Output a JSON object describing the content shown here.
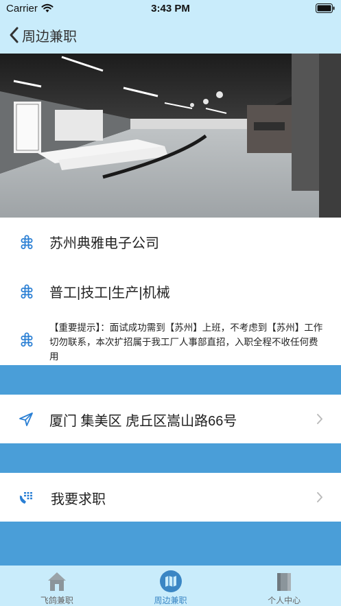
{
  "status_bar": {
    "carrier": "Carrier",
    "time": "3:43 PM"
  },
  "nav": {
    "title": "周边兼职"
  },
  "job": {
    "company": "苏州典雅电子公司",
    "category": "普工|技工|生产|机械",
    "notice": "【重要提示】：面试成功需到【苏州】上班，不考虑到【苏州】工作切勿联系，本次扩招属于我工厂人事部直招，入职全程不收任何费用",
    "address": "厦门 集美区 虎丘区嵩山路66号",
    "apply_label": "我要求职"
  },
  "tabs": [
    {
      "label": "飞鸽兼职",
      "icon": "house-icon"
    },
    {
      "label": "周边兼职",
      "icon": "map-icon"
    },
    {
      "label": "个人中心",
      "icon": "book-icon"
    }
  ],
  "colors": {
    "bar_bg": "#c9ecfb",
    "separator": "#4a9ed8",
    "icon_blue": "#2a7fd4",
    "active_tab": "#3a86c4"
  }
}
